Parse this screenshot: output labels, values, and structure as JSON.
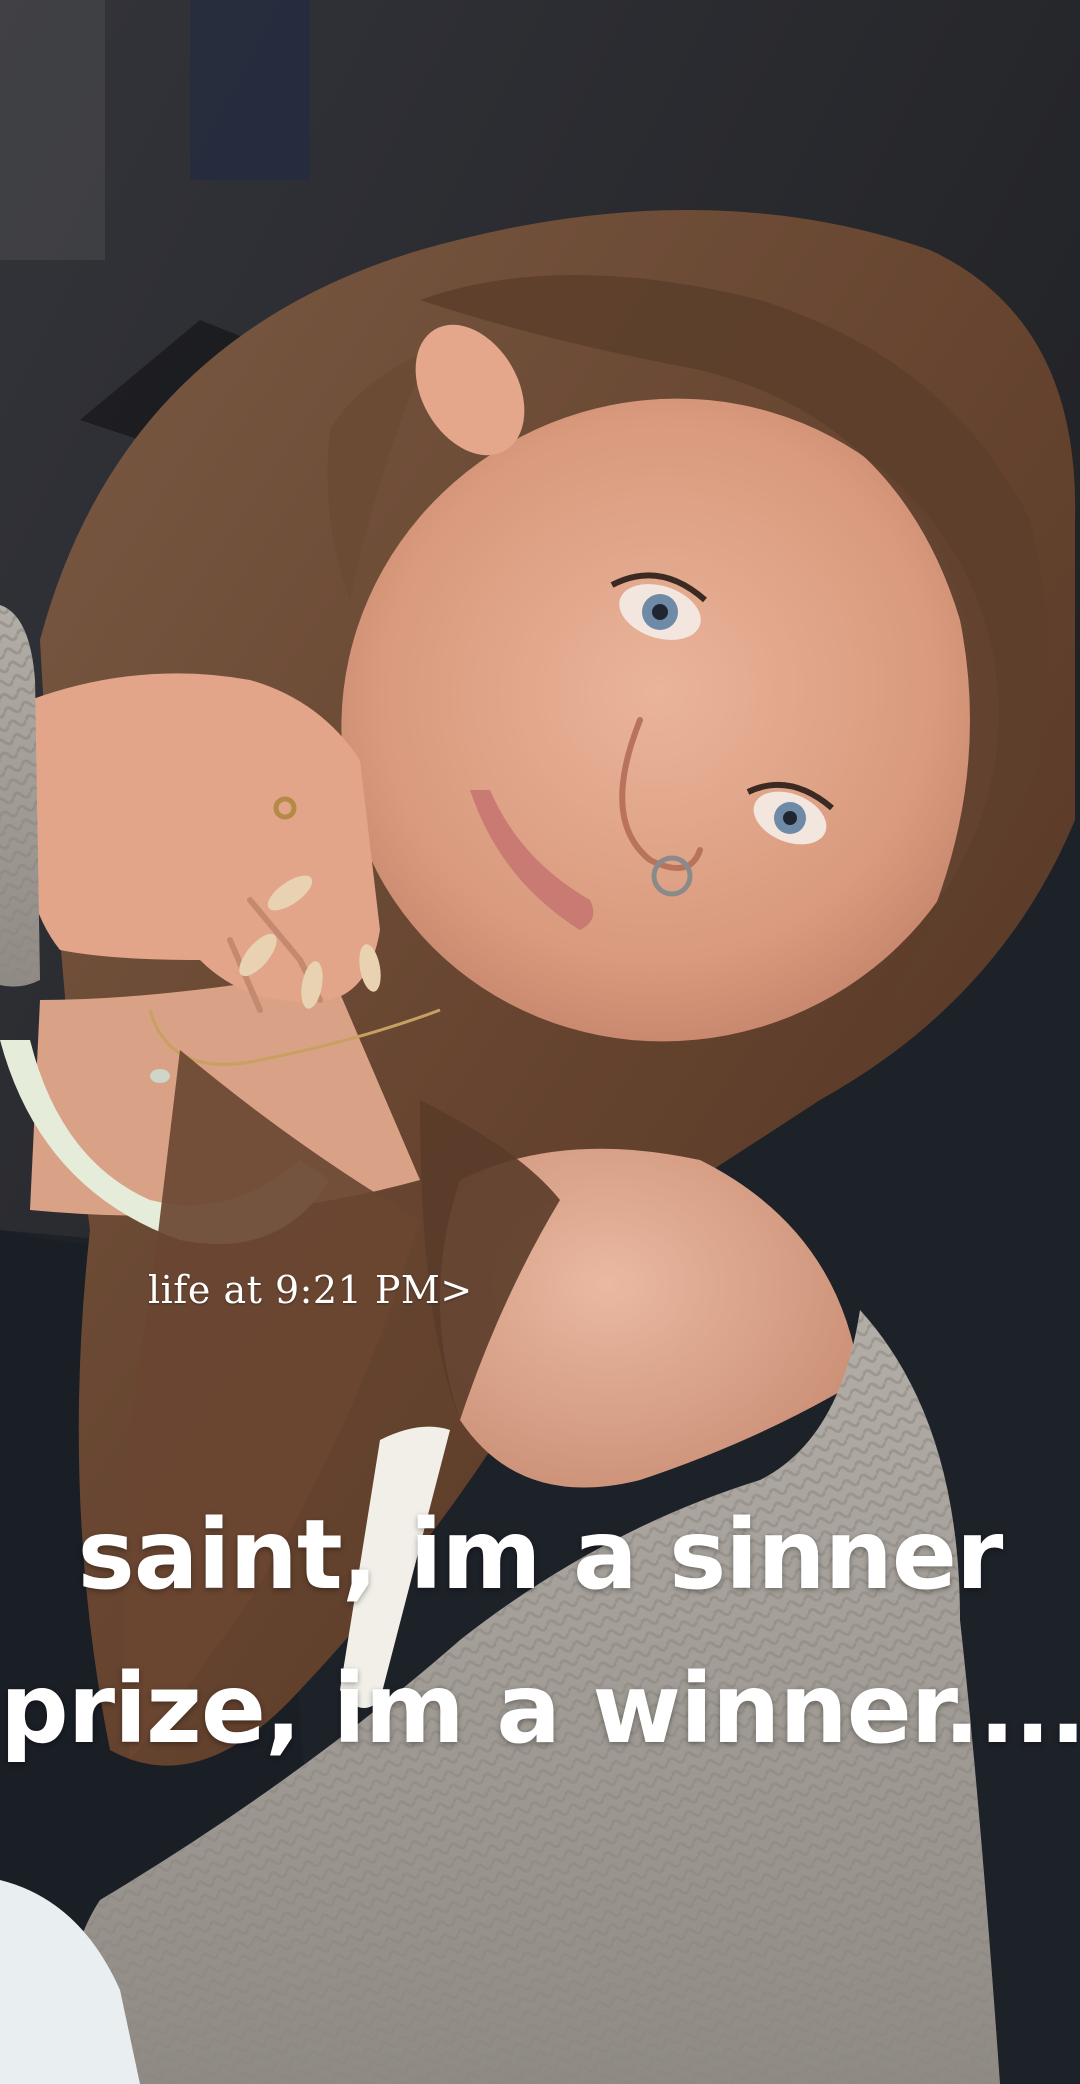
{
  "story": {
    "timestamp": "life at 9:21 PM>",
    "caption_lines": [
      "saint, im a sinner",
      "prize, im a winner...."
    ]
  },
  "colors": {
    "overlay_text": "#ffffff",
    "background": "#25262a",
    "hair": "#6b4a36",
    "skin": "#e3a98f",
    "sweater": "#a8a39c",
    "tank_top": "#1d2128"
  }
}
